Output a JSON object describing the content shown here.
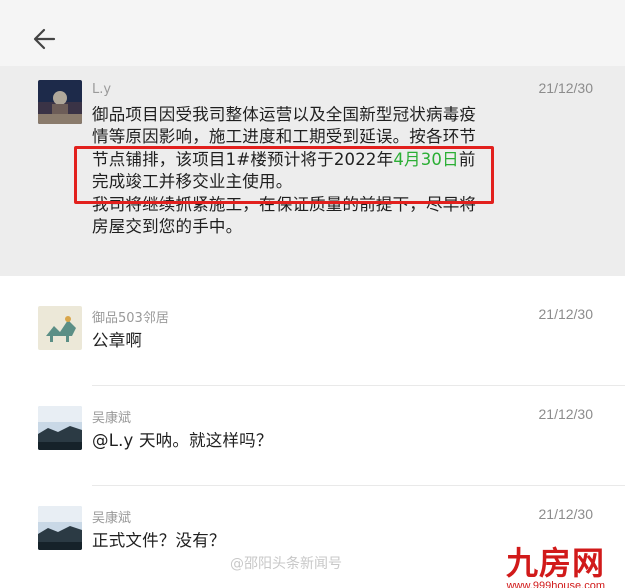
{
  "back_button": {
    "icon": "arrow-left-icon",
    "label": ""
  },
  "messages": [
    {
      "sender": "L.y",
      "time": "21/12/30",
      "lines": [
        "御品项目因受我司整体运营以及全国新型冠状病毒疫",
        "情等原因影响，施工进度和工期受到延误。按各环节",
        "节点铺排，该项目1#楼预计将于2022年",
        "完成竣工并移交业主使用。",
        "我司将继续抓紧施工，在保证质量的前提下，尽早将",
        "房屋交到您的手中。"
      ],
      "highlight_date": "4月30日",
      "after_date": "前"
    },
    {
      "sender": "御品503邻居",
      "time": "21/12/30",
      "text": "公章啊"
    },
    {
      "sender": "吴康斌",
      "time": "21/12/30",
      "text": "@L.y 天呐。就这样吗？"
    },
    {
      "sender": "吴康斌",
      "time": "21/12/30",
      "text": "正式文件？没有？"
    }
  ],
  "watermark": "@邵阳头条新闻号",
  "logo": {
    "title": "九房网",
    "url": "www.999house.com"
  },
  "colors": {
    "highlight_green": "#2aae34",
    "annotation_red": "#e2201d",
    "selected_bg": "#ededed"
  }
}
